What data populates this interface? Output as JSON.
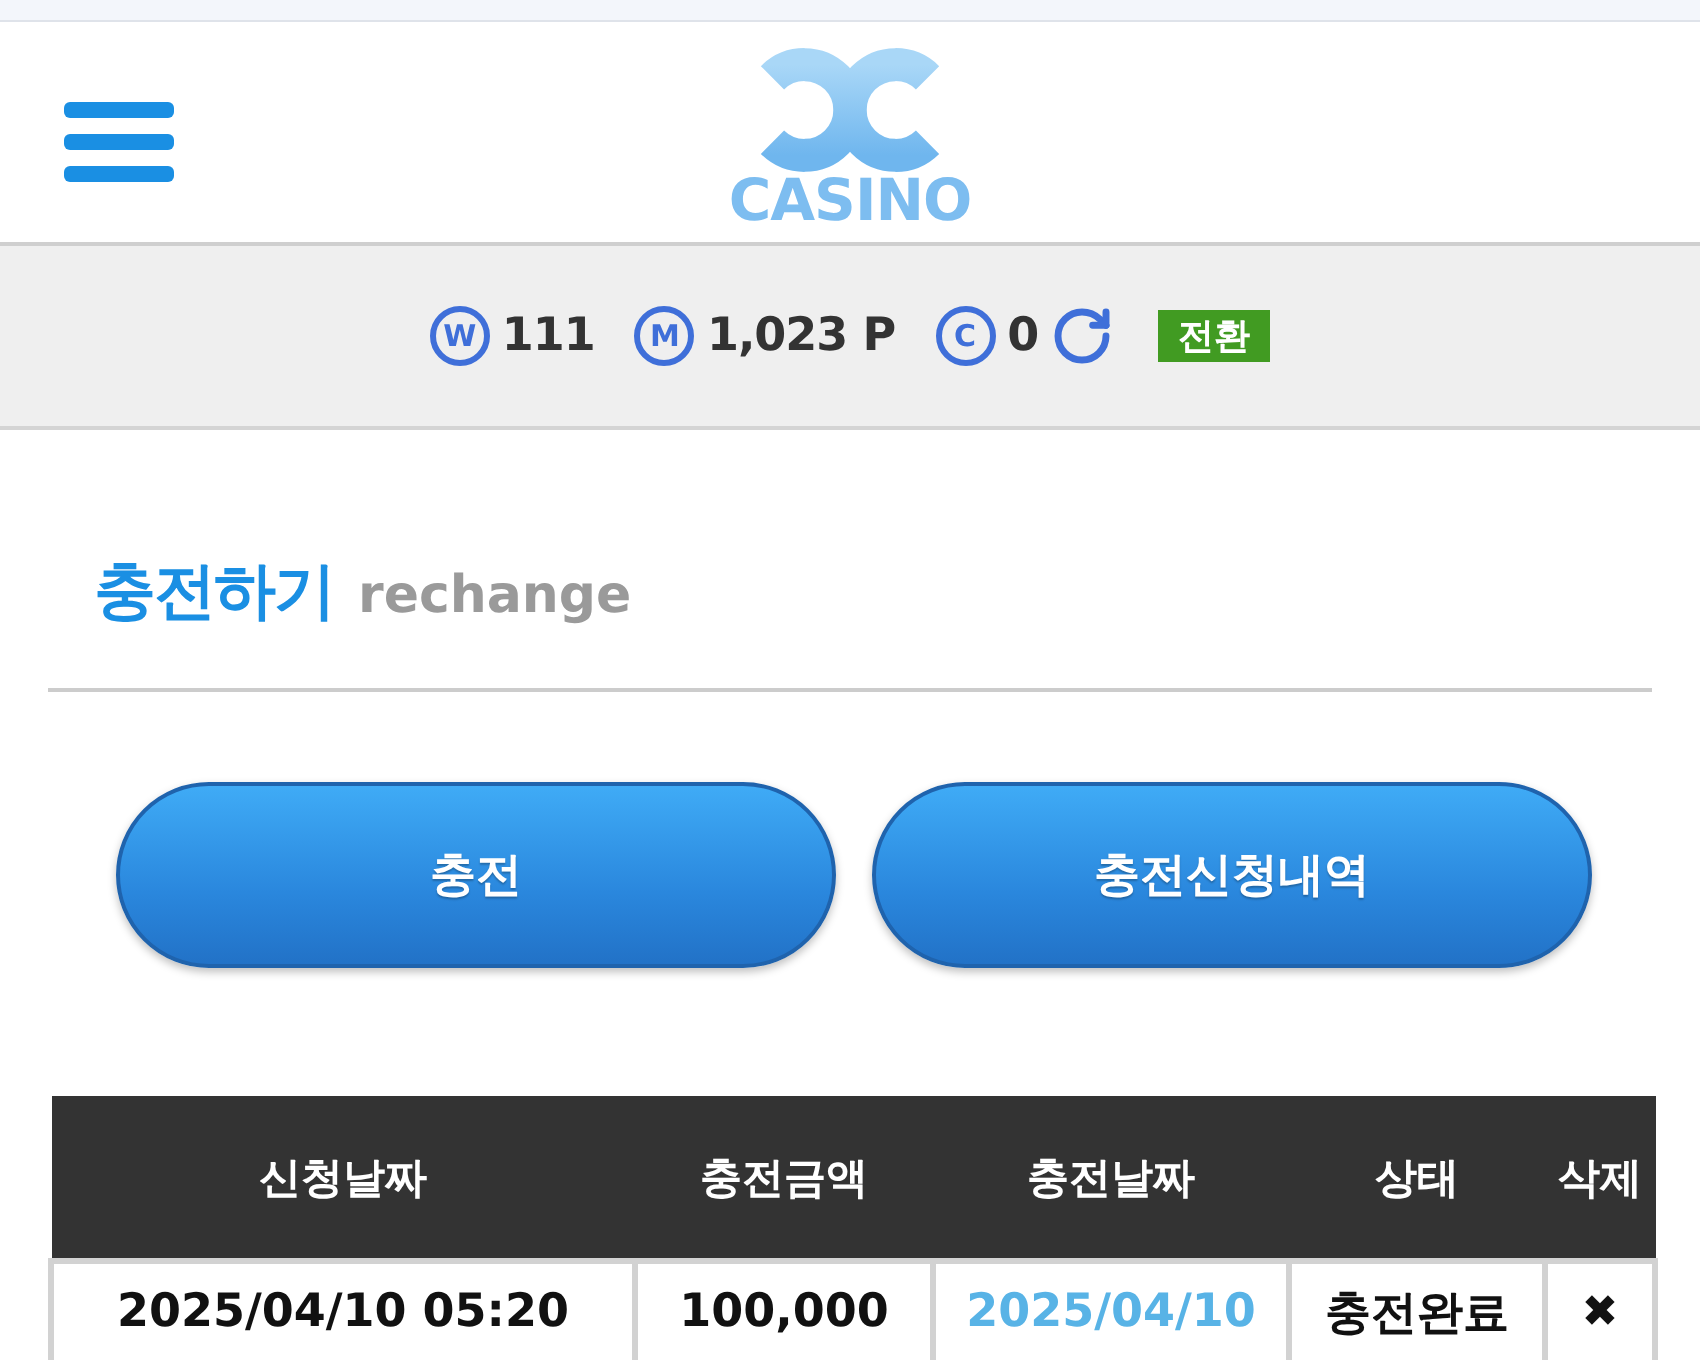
{
  "header": {
    "logo_text": "CASINO"
  },
  "balances": [
    {
      "symbol": "W",
      "amount": "111"
    },
    {
      "symbol": "M",
      "amount": "1,023 P"
    },
    {
      "symbol": "C",
      "amount": "0"
    }
  ],
  "convert_button": "전환",
  "section": {
    "title": "충전하기",
    "subtitle": "rechange"
  },
  "buttons": [
    "충전",
    "충전신청내역"
  ],
  "table": {
    "columns": [
      {
        "label": "신청날짜",
        "kind": "text"
      },
      {
        "label": "충전금액",
        "kind": "text"
      },
      {
        "label": "충전날짜",
        "kind": "date"
      },
      {
        "label": "상태",
        "kind": "text"
      },
      {
        "label": "삭제",
        "kind": "action"
      }
    ],
    "rows": [
      {
        "cells": [
          "2025/04/10 05:20",
          "100,000",
          "2025/04/10",
          "충전완료",
          "✖"
        ]
      }
    ]
  }
}
